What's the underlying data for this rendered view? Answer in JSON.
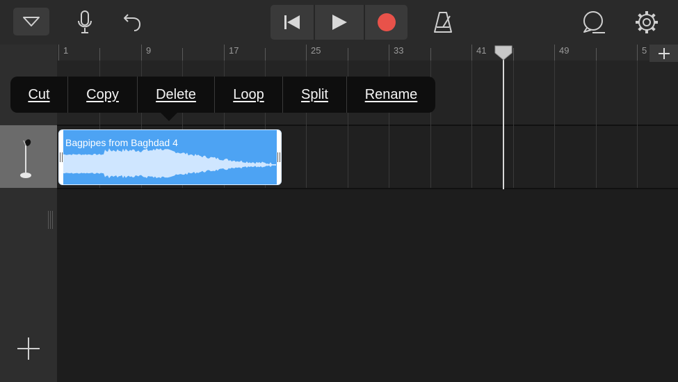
{
  "toolbar": {
    "icons": {
      "tracks_view": "triangle-down-icon",
      "microphone": "microphone-icon",
      "undo": "undo-icon",
      "rewind": "skip-back-icon",
      "play": "play-icon",
      "record": "record-icon",
      "metronome": "metronome-icon",
      "loops": "loop-browser-icon",
      "settings": "gear-icon"
    },
    "record_color": "#e8524a"
  },
  "ruler": {
    "bar_labels": [
      "1",
      "9",
      "17",
      "25",
      "33",
      "41",
      "49",
      "5"
    ],
    "add_icon": "plus-icon"
  },
  "context_menu": {
    "items": [
      {
        "label": "Cut"
      },
      {
        "label": "Copy"
      },
      {
        "label": "Delete"
      },
      {
        "label": "Loop"
      },
      {
        "label": "Split"
      },
      {
        "label": "Rename"
      }
    ]
  },
  "tracks": [
    {
      "instrument_icon": "microphone-stand-icon"
    }
  ],
  "region": {
    "title": "Bagpipes from Baghdad 4",
    "color": "#4da3f3"
  },
  "sidebar": {
    "add_track_icon": "plus-icon"
  }
}
